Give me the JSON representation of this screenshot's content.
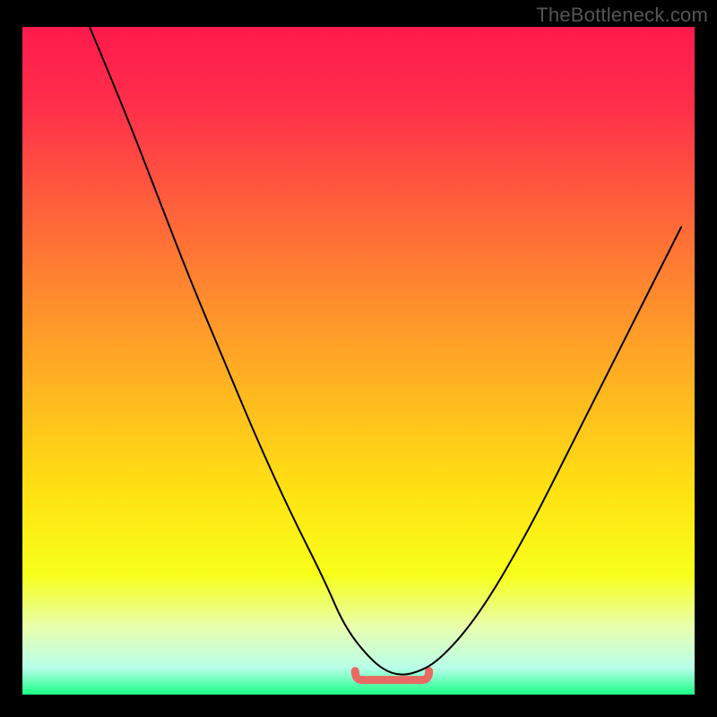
{
  "watermark": "TheBottleneck.com",
  "plot": {
    "viewbox_w": 750,
    "viewbox_h": 745,
    "gradient_stops": [
      {
        "offset": "0%",
        "color": "#ff1a4d"
      },
      {
        "offset": "12%",
        "color": "#ff2f4a"
      },
      {
        "offset": "25%",
        "color": "#ff5a3d"
      },
      {
        "offset": "40%",
        "color": "#ff8a2e"
      },
      {
        "offset": "55%",
        "color": "#ffb820"
      },
      {
        "offset": "70%",
        "color": "#ffe312"
      },
      {
        "offset": "82%",
        "color": "#f7ff1a"
      },
      {
        "offset": "90%",
        "color": "#e8ffb0"
      },
      {
        "offset": "96%",
        "color": "#b8ffea"
      },
      {
        "offset": "100%",
        "color": "#1aff85"
      }
    ]
  },
  "chart_data": {
    "type": "line",
    "title": "",
    "xlabel": "",
    "ylabel": "",
    "xlim": [
      0,
      100
    ],
    "ylim": [
      0,
      100
    ],
    "series": [
      {
        "name": "curve",
        "x": [
          10,
          15,
          20,
          25,
          30,
          35,
          40,
          45,
          48,
          52,
          55,
          58,
          62,
          68,
          75,
          82,
          90,
          98
        ],
        "y": [
          100,
          88,
          75,
          62,
          50,
          38,
          27,
          17,
          10,
          5,
          3,
          3,
          5,
          12,
          24,
          38,
          54,
          70
        ]
      }
    ],
    "valley_highlight": {
      "x_start": 49.5,
      "x_end": 60.5,
      "y": 3,
      "color": "#e96a62"
    }
  }
}
